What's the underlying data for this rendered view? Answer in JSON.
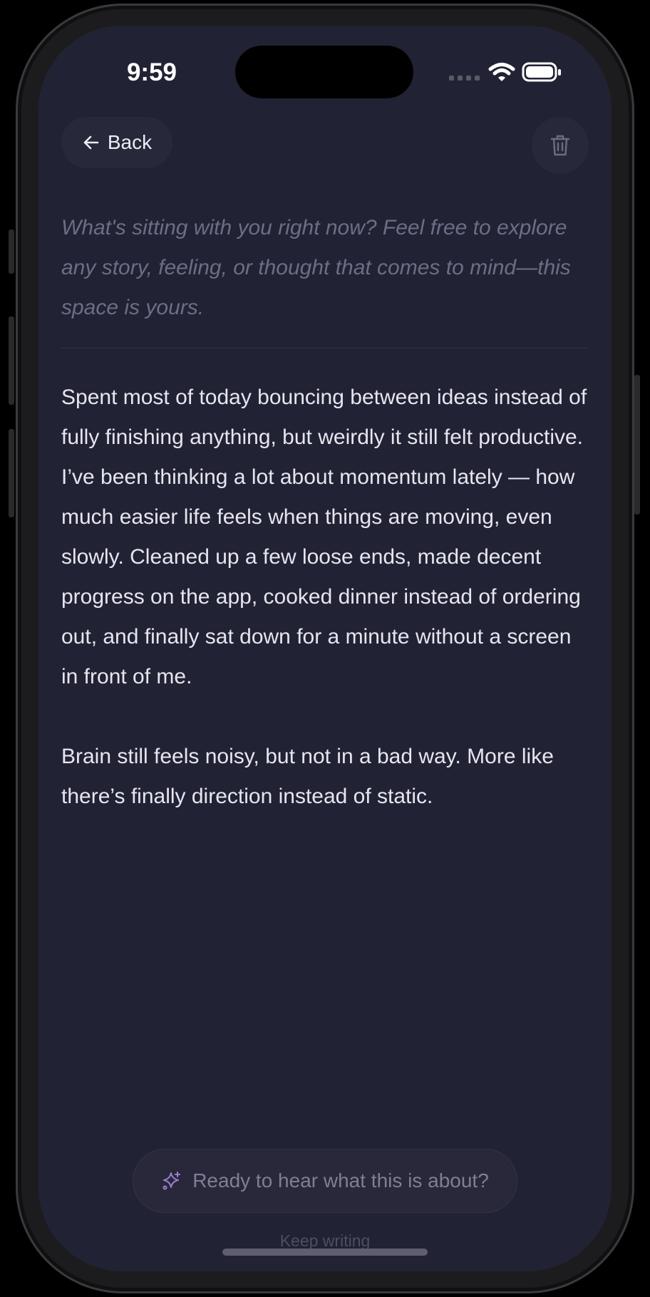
{
  "status_bar": {
    "time": "9:59",
    "signal_icon": "cellular-signal-icon",
    "wifi_icon": "wifi-icon",
    "battery_icon": "battery-icon"
  },
  "header": {
    "back_label": "Back",
    "back_icon": "arrow-left-icon",
    "delete_icon": "trash-icon"
  },
  "journal": {
    "prompt": "What's sitting with you right now? Feel free to explore any story, feeling, or thought that comes to mind—this space is yours.",
    "paragraphs": [
      "Spent most of today bouncing between ideas instead of fully finishing anything, but weirdly it still felt productive. I’ve been thinking a lot about momentum lately — how much easier life feels when things are moving, even slowly. Cleaned up a few loose ends, made decent progress on the app, cooked dinner instead of ordering out, and finally sat down for a minute without a screen in front of me.",
      "Brain still feels noisy, but not in a bad way. More like there’s finally direction instead of static."
    ]
  },
  "footer": {
    "suggest_label": "Ready to hear what this is about?",
    "suggest_icon": "sparkles-icon",
    "keep_writing_label": "Keep writing"
  },
  "colors": {
    "background": "#222235",
    "accent": "#9b7fd4",
    "text": "#e6e6ef",
    "muted_text": "#6d6d85"
  }
}
